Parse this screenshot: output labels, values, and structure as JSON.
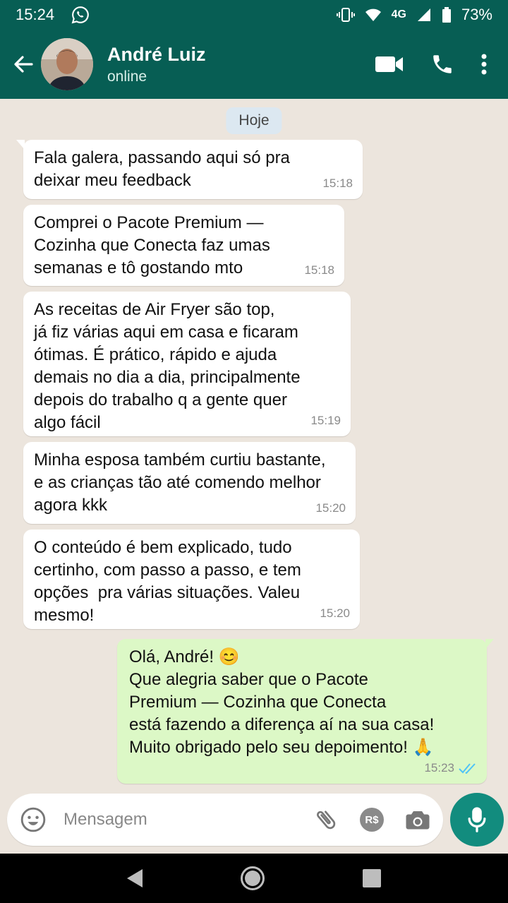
{
  "status_bar": {
    "time": "15:24",
    "network": "4G",
    "battery": "73%"
  },
  "header": {
    "contact_name": "André Luiz",
    "presence": "online"
  },
  "chat": {
    "day_label": "Hoje",
    "messages": [
      {
        "text": "Fala galera, passando aqui só pra\ndeixar meu feedback",
        "time": "15:18",
        "direction": "in"
      },
      {
        "text": "Comprei o Pacote Premium —\nCozinha que Conecta faz umas\nsemanas e tô gostando mto",
        "time": "15:18",
        "direction": "in"
      },
      {
        "text": "As receitas de Air Fryer são top,\njá fiz várias aqui em casa e ficaram\nótimas. É prático, rápido e ajuda\ndemais no dia a dia, principalmente\ndepois do trabalho q a gente quer\nalgo fácil",
        "time": "15:19",
        "direction": "in"
      },
      {
        "text": "Minha esposa também curtiu bastante,\ne as crianças tão até comendo melhor\nagora kkk",
        "time": "15:20",
        "direction": "in"
      },
      {
        "text": "O conteúdo é bem explicado, tudo\ncertinho, com passo a passo, e tem\nopções  pra várias situações. Valeu\nmesmo!",
        "time": "15:20",
        "direction": "in"
      },
      {
        "text": "Olá, André! 😊\nQue alegria saber que o Pacote\nPremium — Cozinha que Conecta\nestá fazendo a diferença aí na sua casa!\nMuito obrigado pelo seu depoimento! 🙏",
        "time": "15:23",
        "direction": "out",
        "status": "read"
      }
    ]
  },
  "composer": {
    "placeholder": "Mensagem",
    "payment_label": "R$"
  },
  "colors": {
    "header": "#075e54",
    "accent": "#128c7e",
    "outgoing_bubble": "#dcf8c6",
    "read_ticks": "#4fc3f7"
  }
}
